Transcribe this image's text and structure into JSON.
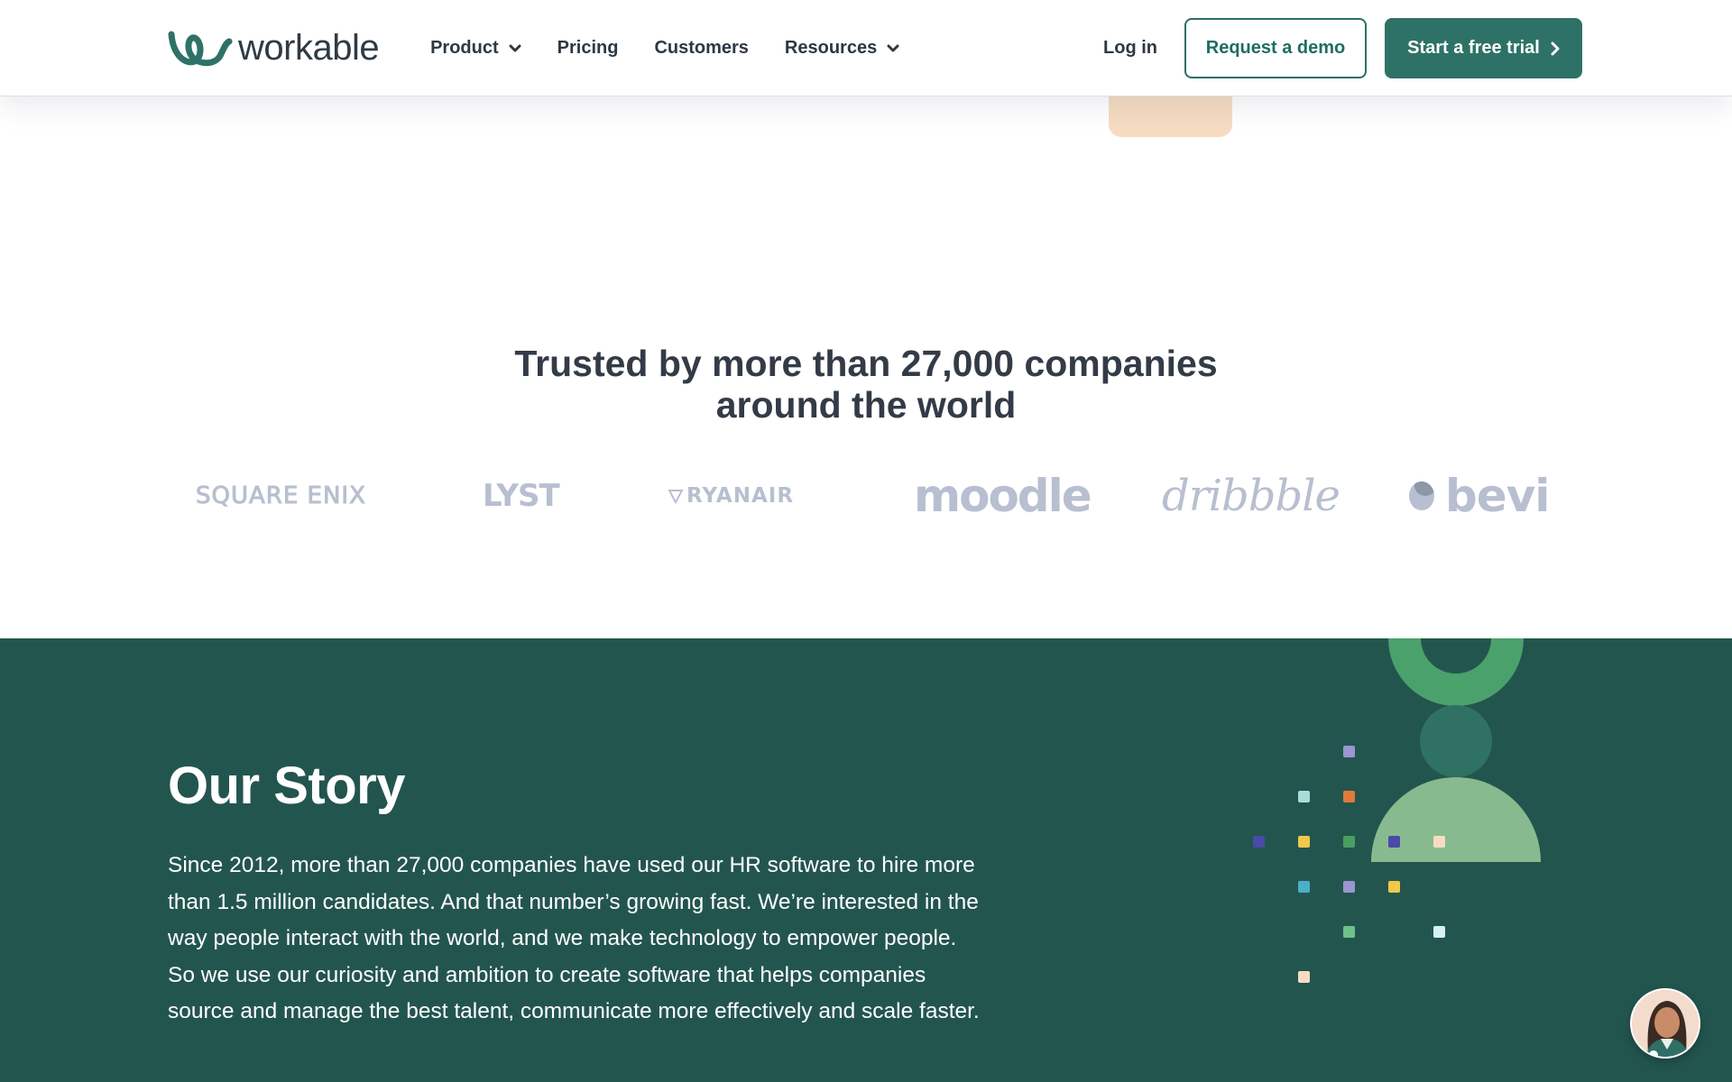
{
  "header": {
    "logo_text": "workable",
    "nav": [
      {
        "label": "Product",
        "has_dropdown": true
      },
      {
        "label": "Pricing",
        "has_dropdown": false
      },
      {
        "label": "Customers",
        "has_dropdown": false
      },
      {
        "label": "Resources",
        "has_dropdown": true
      }
    ],
    "login_label": "Log in",
    "demo_label": "Request a demo",
    "trial_label": "Start a free trial"
  },
  "trusted": {
    "title_line1": "Trusted by more than 27,000 companies",
    "title_line2": "around the world",
    "logos": [
      "SQUARE ENIX",
      "LYST",
      "RYANAIR",
      "moodle",
      "dribbble",
      "bevi"
    ]
  },
  "story": {
    "title": "Our Story",
    "body": "Since 2012, more than 27,000 companies have used our HR software to hire more than 1.5 million candidates. And that number’s growing fast. We’re interested in the way people interact with the world, and we make technology to empower people. So we use our curiosity and ambition to create software that helps companies source and manage the best talent, communicate more effectively and scale faster."
  },
  "icons": {
    "logo": "workable-logo-icon",
    "dropdown": "chevron-down-icon",
    "trial_arrow": "chevron-right-icon",
    "chat": "chat-assistant-avatar-icon"
  },
  "colors": {
    "brand_green": "#2e7267",
    "story_bg": "#23554f",
    "logo_gray": "#b7bfd0",
    "peach": "#f7dcc2"
  }
}
